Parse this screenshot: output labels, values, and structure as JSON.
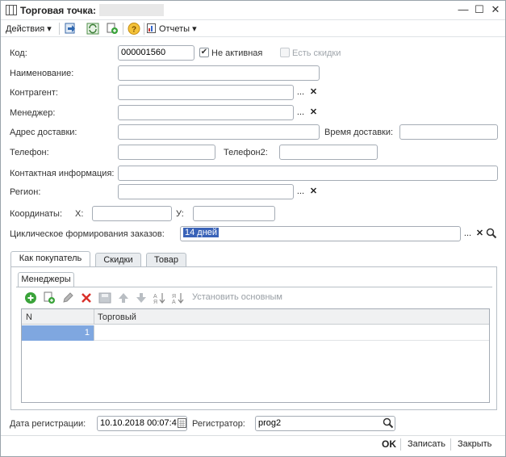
{
  "window": {
    "title": "Торговая точка:",
    "minimize": "—",
    "maximize": "☐",
    "close": "✕"
  },
  "toolbar": {
    "actions_label": "Действия",
    "reports_label": "Отчеты"
  },
  "form": {
    "code_label": "Код:",
    "code_value": "000001560",
    "inactive_label": "Не активная",
    "inactive_checked": true,
    "discounts_label": "Есть скидки",
    "name_label": "Наименование:",
    "counterparty_label": "Контрагент:",
    "manager_label": "Менеджер:",
    "delivery_address_label": "Адрес доставки:",
    "delivery_time_label": "Время доставки:",
    "phone_label": "Телефон:",
    "phone2_label": "Телефон2:",
    "contact_label": "Контактная информация:",
    "region_label": "Регион:",
    "coords_label": "Координаты:",
    "x_label": "X:",
    "y_label": "У:",
    "cycle_label": "Циклическое формирования заказов:",
    "cycle_value": "14 дней",
    "dots": "...",
    "clear": "✕"
  },
  "tabs": [
    {
      "label": "Как покупатель"
    },
    {
      "label": "Скидки"
    },
    {
      "label": "Товар"
    }
  ],
  "subtab": {
    "label": "Менеджеры"
  },
  "grid_toolbar": {
    "set_main_label": "Установить основным"
  },
  "grid": {
    "columns": [
      "N",
      "Торговый"
    ],
    "rows": [
      {
        "n": "1",
        "trader": ""
      }
    ]
  },
  "bottom": {
    "reg_date_label": "Дата регистрации:",
    "reg_date_value": "10.10.2018 00:07:4",
    "registrar_label": "Регистратор:",
    "registrar_value": "prog2"
  },
  "footer": {
    "ok_label": "OK",
    "save_label": "Записать",
    "close_label": "Закрыть"
  },
  "colors": {
    "selected_row": "#7fa7e0",
    "selected_text": "#3a63b8",
    "add_green": "#3aa33a",
    "delete_red": "#d9302a"
  }
}
